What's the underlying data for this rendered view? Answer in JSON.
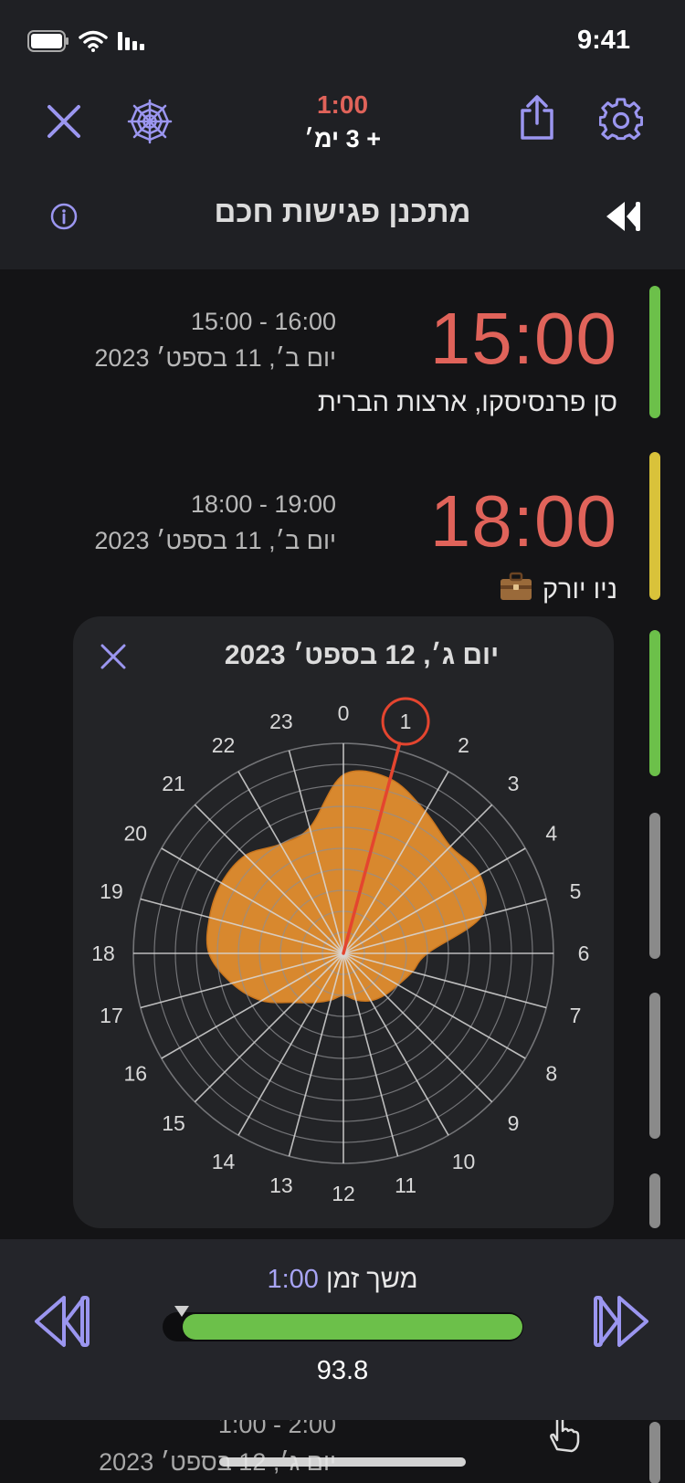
{
  "status_bar": {
    "time": "9:41"
  },
  "header": {
    "duration": "1:00",
    "days_offset": "+ 3 ימ׳",
    "title": "מתכנן פגישות חכם"
  },
  "entries": [
    {
      "big_time": "15:00",
      "range": "15:00 - 16:00",
      "date": "יום ב׳, 11 בספט׳ 2023",
      "place": "סן פרנסיסקו, ארצות הברית",
      "bar_color": "#6cc04a"
    },
    {
      "big_time": "18:00",
      "range": "18:00 - 19:00",
      "date": "יום ב׳, 11 בספט׳ 2023",
      "place": "ניו יורק",
      "place_icon": "briefcase-icon",
      "bar_color": "#d9c23a"
    }
  ],
  "side_bars": [
    "#6cc04a",
    "#8a8a8a",
    "#8a8a8a",
    "#8a8a8a"
  ],
  "popup": {
    "title": "יום ג׳, 12 בספט׳ 2023",
    "selected_hour": "1",
    "hour_labels": [
      "0",
      "1",
      "2",
      "3",
      "4",
      "5",
      "6",
      "7",
      "8",
      "9",
      "10",
      "11",
      "12",
      "13",
      "14",
      "15",
      "16",
      "17",
      "18",
      "19",
      "20",
      "21",
      "22",
      "23"
    ]
  },
  "chart_data": {
    "type": "radar",
    "title": "יום ג׳, 12 בספט׳ 2023",
    "categories": [
      "0",
      "1",
      "2",
      "3",
      "4",
      "5",
      "6",
      "7",
      "8",
      "9",
      "10",
      "11",
      "12",
      "13",
      "14",
      "15",
      "16",
      "17",
      "18",
      "19",
      "20",
      "21",
      "22",
      "23"
    ],
    "rings": 10,
    "series": [
      {
        "values": [
          8.5,
          8.6,
          7.8,
          7.2,
          7.5,
          6.8,
          4.0,
          3.4,
          3.0,
          2.8,
          2.6,
          2.3,
          2.0,
          2.3,
          2.7,
          3.3,
          4.5,
          5.5,
          6.4,
          6.6,
          6.7,
          6.6,
          6.0,
          6.2
        ],
        "color": "#e8912f"
      }
    ],
    "selected": "1",
    "colors": {
      "fill": "#e8912f",
      "grid": "#8f8f93",
      "needle": "#e4452f",
      "highlight": "#e4452f"
    }
  },
  "bottom": {
    "duration_label": "משך זמן",
    "duration_value": "1:00",
    "score": "93.8"
  },
  "under_text": {
    "range": "1:00 - 2:00",
    "date": "יום ג׳, 12 בספט׳ 2023"
  },
  "colors": {
    "accent": "#9b96f0",
    "time": "#e0635a",
    "green": "#6cc04a",
    "yellow": "#d9c23a"
  }
}
